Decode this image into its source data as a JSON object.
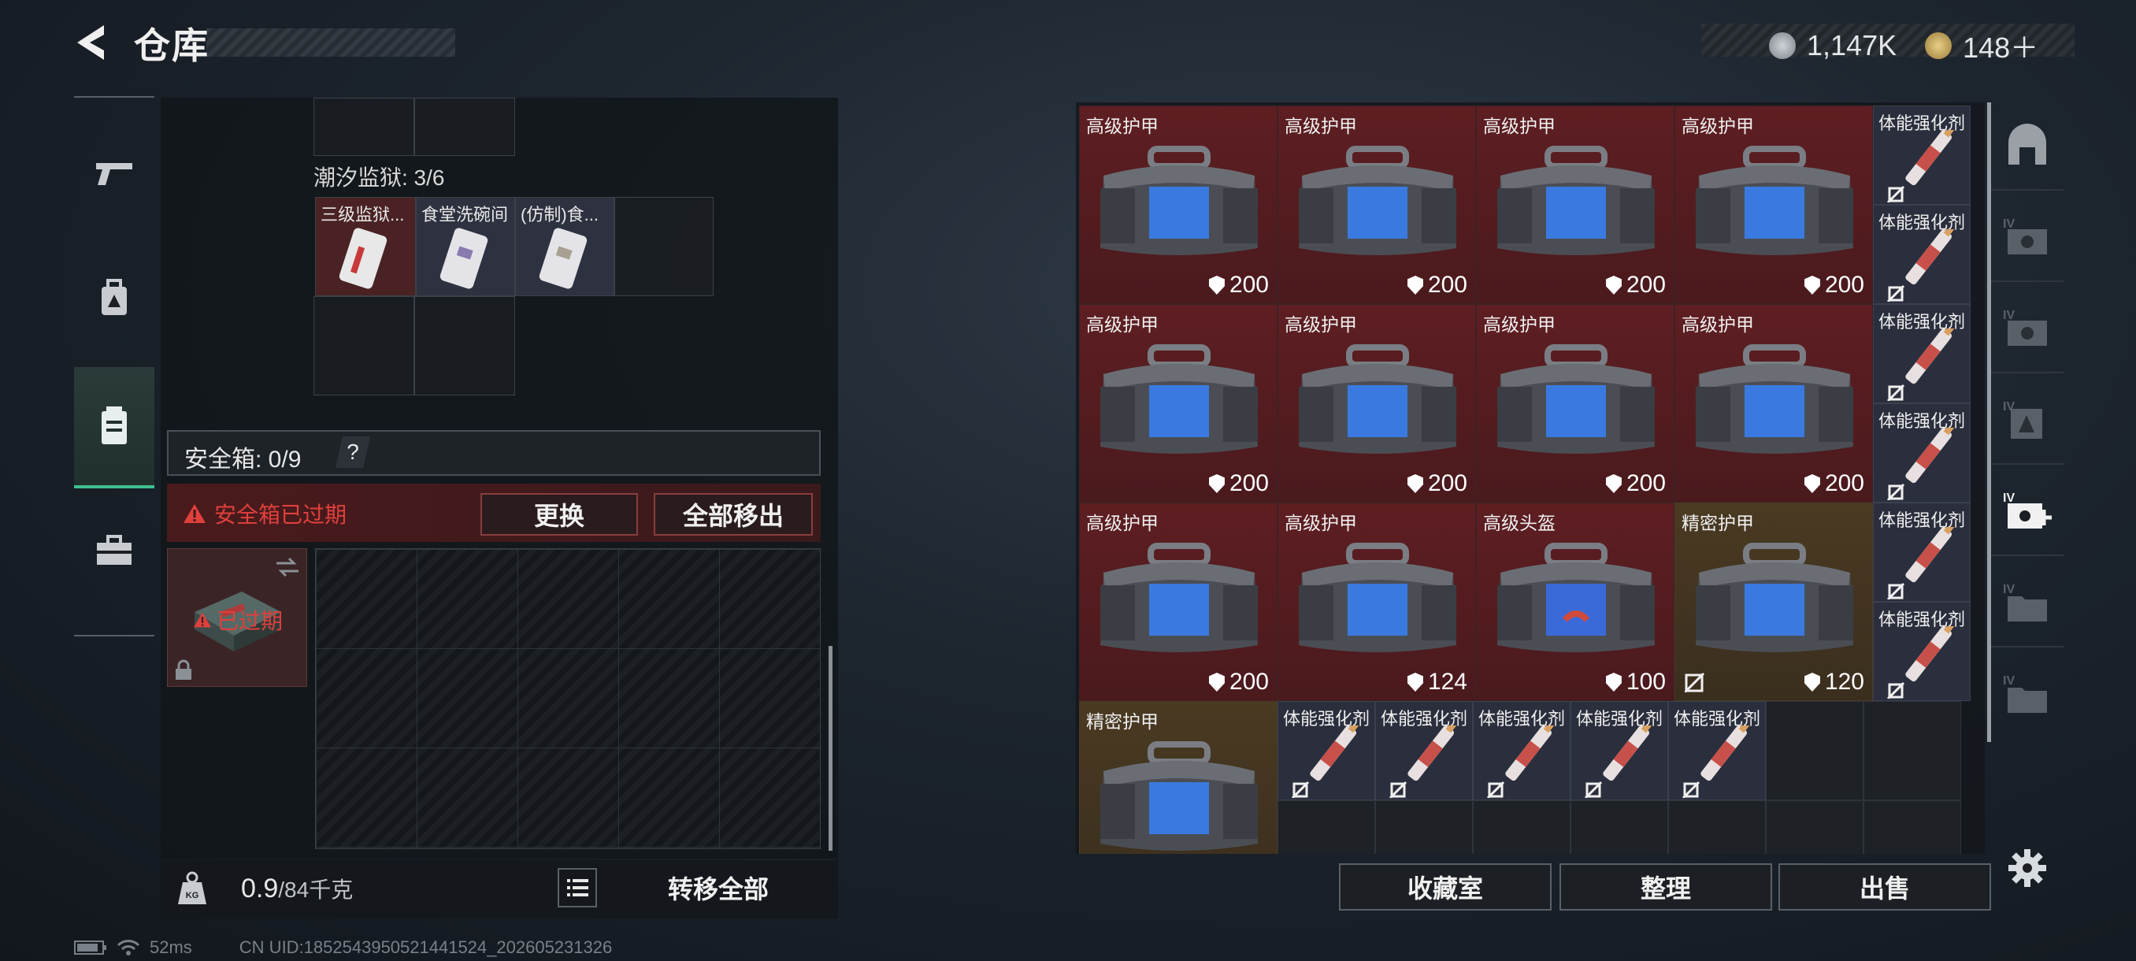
{
  "header": {
    "title": "仓库"
  },
  "currency": [
    {
      "icon": "silver-coin-icon",
      "value": "1,147K"
    },
    {
      "icon": "gold-coin-icon",
      "value": "148＋"
    }
  ],
  "left_nav": [
    {
      "icon": "gun-icon"
    },
    {
      "icon": "backpack-icon"
    },
    {
      "icon": "container-icon",
      "active": true
    },
    {
      "icon": "toolbox-icon"
    }
  ],
  "prison": {
    "label": "潮汐监狱: 3/6",
    "items": [
      "三级监狱...",
      "食堂洗碗间",
      "(仿制)食..."
    ]
  },
  "safebox": {
    "label": "安全箱: 0/9",
    "help": "?",
    "expired_msg": "安全箱已过期",
    "replace": "更换",
    "move_all": "全部移出",
    "badge": "已过期"
  },
  "weight": {
    "current": "0.9",
    "max": "/84千克"
  },
  "transfer_all": "转移全部",
  "status": {
    "ping": "52ms",
    "uid": "CN UID:1852543950521441524_202605231326"
  },
  "stash_items": [
    {
      "name": "高级护甲",
      "value": "200",
      "kind": "armor",
      "bg": "red"
    },
    {
      "name": "高级护甲",
      "value": "200",
      "kind": "armor",
      "bg": "red"
    },
    {
      "name": "高级护甲",
      "value": "200",
      "kind": "armor",
      "bg": "red"
    },
    {
      "name": "高级护甲",
      "value": "200",
      "kind": "armor",
      "bg": "red"
    },
    {
      "name": "高级护甲",
      "value": "200",
      "kind": "armor",
      "bg": "red"
    },
    {
      "name": "高级护甲",
      "value": "200",
      "kind": "armor",
      "bg": "red"
    },
    {
      "name": "高级护甲",
      "value": "200",
      "kind": "armor",
      "bg": "red"
    },
    {
      "name": "高级护甲",
      "value": "200",
      "kind": "armor",
      "bg": "red"
    },
    {
      "name": "高级护甲",
      "value": "200",
      "kind": "armor",
      "bg": "red"
    },
    {
      "name": "高级护甲",
      "value": "124",
      "kind": "armor",
      "bg": "red"
    },
    {
      "name": "高级头盔",
      "value": "100",
      "kind": "helmet",
      "bg": "red"
    },
    {
      "name": "精密护甲",
      "value": "120",
      "kind": "armor",
      "bg": "gold"
    },
    {
      "name": "精密护甲",
      "value": "",
      "kind": "armor",
      "bg": "gold"
    }
  ],
  "consumable_label": "体能强化剂",
  "buttons": {
    "collection": "收藏室",
    "sort": "整理",
    "sell": "出售"
  },
  "right_nav": [
    {
      "icon": "locker-icon"
    },
    {
      "icon": "safe-iv-icon"
    },
    {
      "icon": "safe-iv-icon"
    },
    {
      "icon": "backpack-iv-icon"
    },
    {
      "icon": "add-safe-icon"
    },
    {
      "icon": "folder-iv-icon"
    },
    {
      "icon": "folder-iv-icon"
    }
  ],
  "colors": {
    "accent": "#3fbf8f",
    "danger": "#e0403c",
    "rarity_red": "#5e1e22",
    "rarity_gold": "#4a3a22"
  }
}
